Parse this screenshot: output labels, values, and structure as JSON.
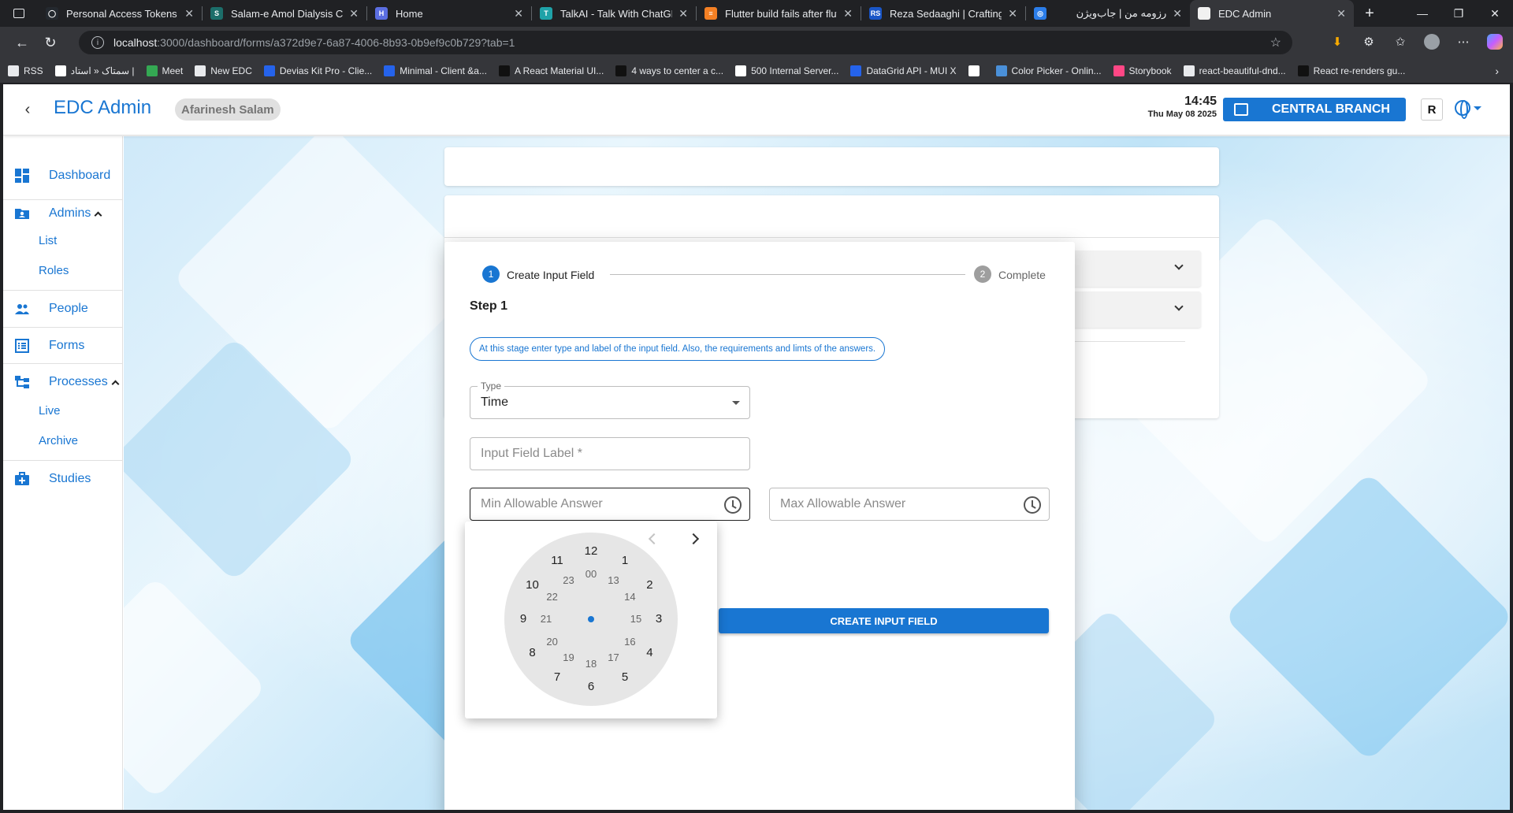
{
  "browser": {
    "tabs": [
      {
        "title": "Personal Access Tokens (Cla",
        "fav_color": "#24292f",
        "fav_glyph": "◯"
      },
      {
        "title": "Salam-e Amol Dialysis Clinic",
        "fav_color": "#1c6e6a",
        "fav_glyph": "S"
      },
      {
        "title": "Home",
        "fav_color": "#5b6ee1",
        "fav_glyph": "H"
      },
      {
        "title": "TalkAI - Talk With ChatGPT",
        "fav_color": "#1fa2a8",
        "fav_glyph": "T"
      },
      {
        "title": "Flutter build fails after flutt",
        "fav_color": "#f48024",
        "fav_glyph": "≡"
      },
      {
        "title": "Reza Sedaaghi | Crafting Sc",
        "fav_color": "#1a56c7",
        "fav_glyph": "RS"
      },
      {
        "title": "رزومه من | جاب‌ویژن",
        "fav_color": "#2b7de9",
        "fav_glyph": "◎"
      },
      {
        "title": "EDC Admin",
        "fav_color": "#f1f1f1",
        "fav_glyph": ""
      }
    ],
    "url_host": "localhost",
    "url_path": ":3000/dashboard/forms/a372d9e7-6a87-4006-8b93-0b9ef9c0b729?tab=1",
    "bookmarks": [
      {
        "label": "RSS",
        "color": "#e8eaed"
      },
      {
        "label": "سمتاک « استاد |",
        "color": "#ffffff"
      },
      {
        "label": "Meet",
        "color": "#34a853"
      },
      {
        "label": "New EDC",
        "color": "#e8eaed"
      },
      {
        "label": "Devias Kit Pro - Clie...",
        "color": "#2563eb"
      },
      {
        "label": "Minimal - Client &a...",
        "color": "#2563eb"
      },
      {
        "label": "A React Material UI...",
        "color": "#111111"
      },
      {
        "label": "4 ways to center a c...",
        "color": "#111111"
      },
      {
        "label": "500 Internal Server...",
        "color": "#ffffff"
      },
      {
        "label": "DataGrid API - MUI X",
        "color": "#2563eb"
      },
      {
        "label": "",
        "color": "#ffffff"
      },
      {
        "label": "Color Picker - Onlin...",
        "color": "#4a90d9"
      },
      {
        "label": "Storybook",
        "color": "#ff4785"
      },
      {
        "label": "react-beautiful-dnd...",
        "color": "#e8eaed"
      },
      {
        "label": "React re-renders gu...",
        "color": "#111111"
      }
    ]
  },
  "app": {
    "brand": "EDC Admin",
    "user": "Afarinesh Salam",
    "time": "14:45",
    "date": "Thu May 08 2025",
    "branch": "CENTRAL BRANCH",
    "r_button": "R"
  },
  "sidebar": {
    "dashboard": "Dashboard",
    "admins": "Admins",
    "admins_list": "List",
    "admins_roles": "Roles",
    "people": "People",
    "forms": "Forms",
    "processes": "Processes",
    "processes_live": "Live",
    "processes_archive": "Archive",
    "studies": "Studies"
  },
  "modal": {
    "step1_num": "1",
    "step1_label": "Create Input Field",
    "step2_num": "2",
    "step2_label": "Complete",
    "step_title": "Step 1",
    "hint": "At this stage enter type and label of the input field. Also, the requirements and limts of the answers.",
    "type_legend": "Type",
    "type_value": "Time",
    "label_placeholder": "Input Field Label *",
    "min_placeholder": "Min Allowable Answer",
    "max_placeholder": "Max Allowable Answer",
    "create_button": "CREATE INPUT FIELD"
  },
  "clock_picker": {
    "outer_hours": [
      "12",
      "1",
      "2",
      "3",
      "4",
      "5",
      "6",
      "7",
      "8",
      "9",
      "10",
      "11"
    ],
    "inner_hours": [
      "00",
      "13",
      "14",
      "15",
      "16",
      "17",
      "18",
      "19",
      "20",
      "21",
      "22",
      "23"
    ]
  },
  "colors": {
    "accent": "#1976d2",
    "step_inactive": "#9e9e9e"
  }
}
